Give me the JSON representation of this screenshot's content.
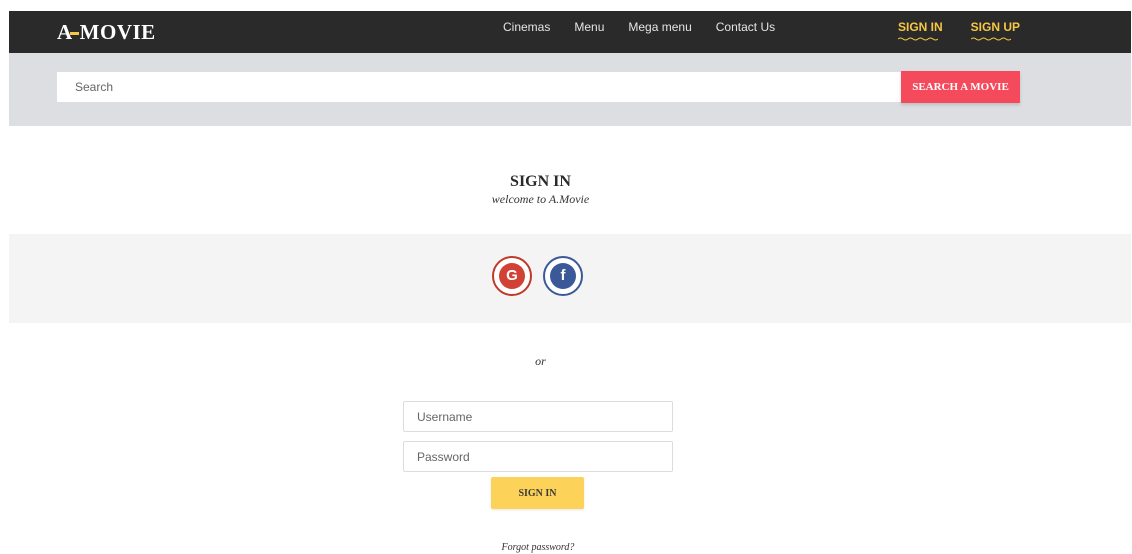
{
  "header": {
    "logo_text": "MOVIE",
    "logo_prefix": "A",
    "nav": [
      "Cinemas",
      "Menu",
      "Mega menu",
      "Contact Us"
    ],
    "sign_in": "SIGN IN",
    "sign_up": "SIGN UP"
  },
  "search": {
    "placeholder": "Search",
    "button_label": "SEARCH A MOVIE"
  },
  "main": {
    "title": "SIGN IN",
    "subtitle": "welcome to A.Movie",
    "social": {
      "google_glyph": "G",
      "facebook_glyph": "f"
    },
    "or_text": "or",
    "username_placeholder": "Username",
    "password_placeholder": "Password",
    "submit_label": "SIGN IN",
    "forgot_password": "Forgot password?"
  },
  "colors": {
    "nav_bg": "#2b2a2b",
    "accent_yellow": "#f6c744",
    "search_button": "#f44a5b",
    "google": "#d14136",
    "facebook": "#3b5998",
    "signin_button": "#fdd258"
  }
}
